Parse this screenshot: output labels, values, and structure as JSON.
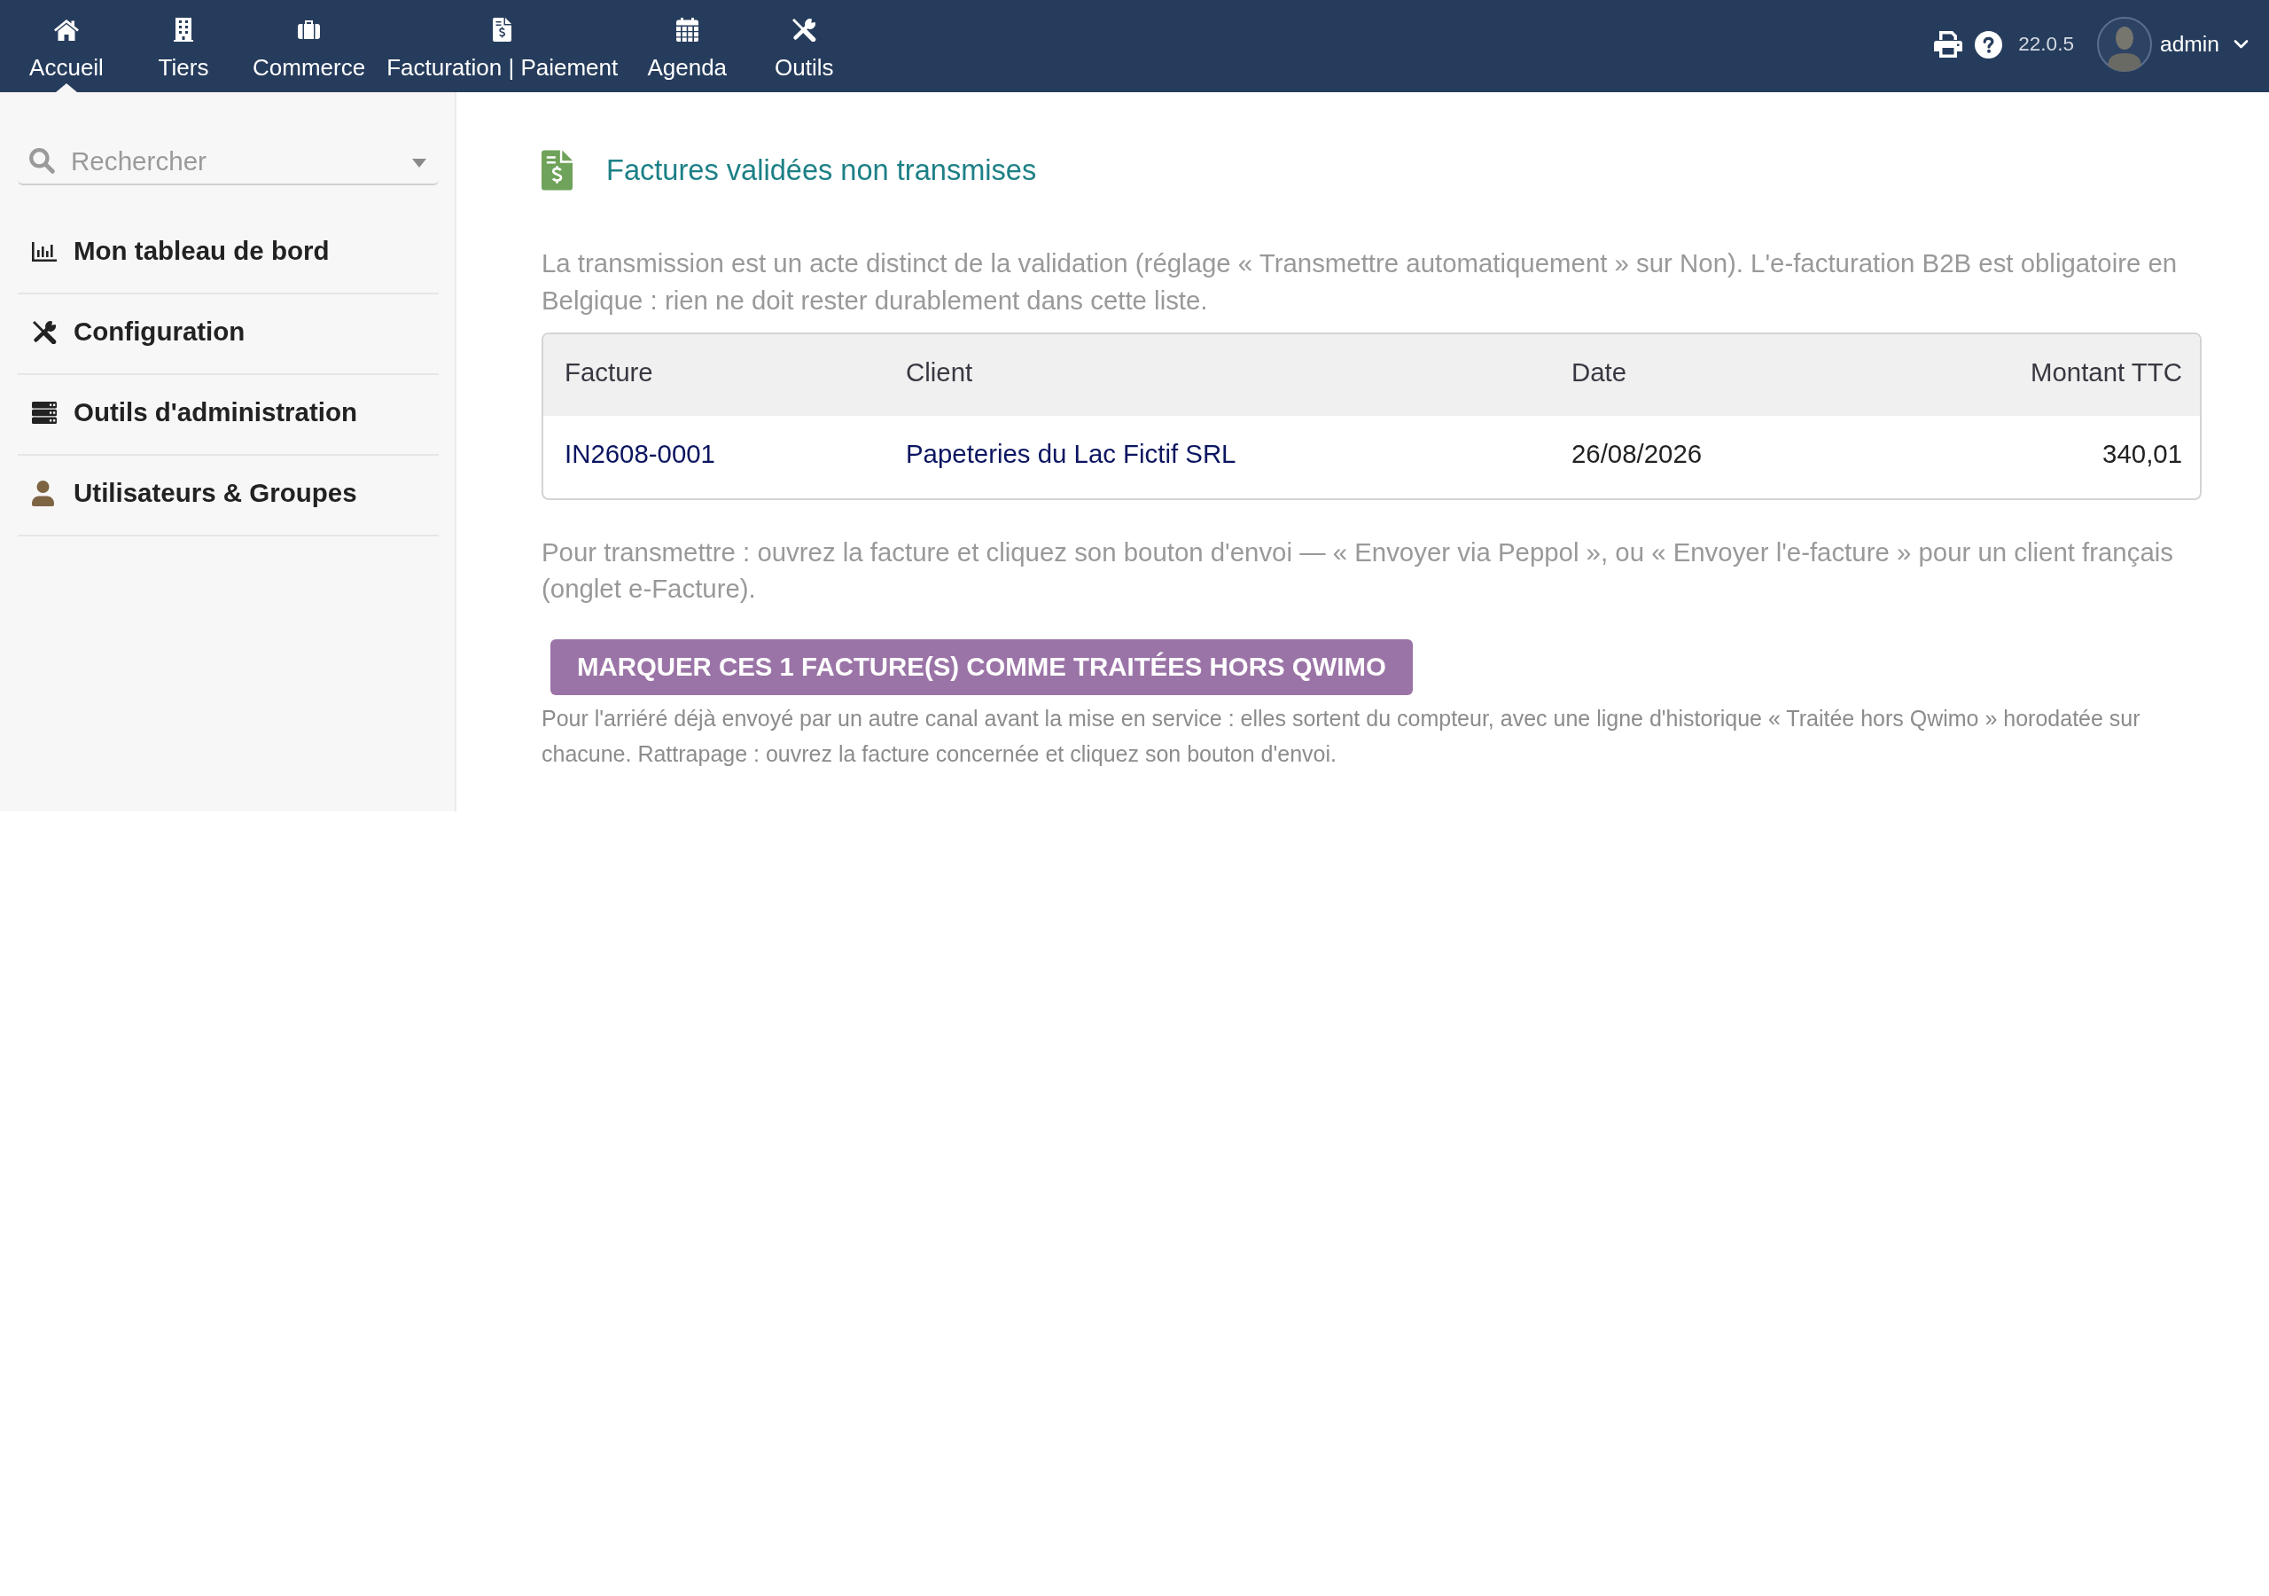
{
  "top_nav": {
    "items": [
      {
        "label": "Accueil",
        "selected": true
      },
      {
        "label": "Tiers",
        "selected": false
      },
      {
        "label": "Commerce",
        "selected": false
      },
      {
        "label": "Facturation | Paiement",
        "selected": false
      },
      {
        "label": "Agenda",
        "selected": false
      },
      {
        "label": "Outils",
        "selected": false
      }
    ],
    "version": "22.0.5",
    "user": "admin"
  },
  "sidebar": {
    "search": {
      "placeholder": "Rechercher"
    },
    "items": [
      {
        "label": "Mon tableau de bord"
      },
      {
        "label": "Configuration"
      },
      {
        "label": "Outils d'administration"
      },
      {
        "label": "Utilisateurs & Groupes"
      }
    ]
  },
  "main": {
    "title": "Factures validées non transmises",
    "intro": "La transmission est un acte distinct de la validation (réglage « Transmettre automatiquement » sur Non). L'e-facturation B2B est obligatoire en Belgique : rien ne doit rester durablement dans cette liste.",
    "table": {
      "columns": [
        "Facture",
        "Client",
        "Date",
        "Montant TTC"
      ],
      "rows": [
        {
          "cells": [
            {
              "text": "IN2608-0001",
              "kind": "link"
            },
            {
              "text": "Papeteries du Lac Fictif SRL",
              "kind": "link"
            },
            {
              "text": "26/08/2026",
              "kind": "text"
            },
            {
              "text": "340,01",
              "kind": "text"
            }
          ]
        }
      ]
    },
    "instructions": "Pour transmettre : ouvrez la facture et cliquez son bouton d'envoi — « Envoyer via Peppol », ou « Envoyer l'e-facture » pour un client français (onglet e-Facture).",
    "action_button": "MARQUER CES 1 FACTURE(S) COMME TRAITÉES HORS QWIMO",
    "note": "Pour l'arriéré déjà envoyé par un autre canal avant la mise en service : elles sortent du compteur, avec une ligne d'historique « Traitée hors Qwimo » horodatée sur chacune. Rattrapage : ouvrez la facture concernée et cliquez son bouton d'envoi."
  }
}
